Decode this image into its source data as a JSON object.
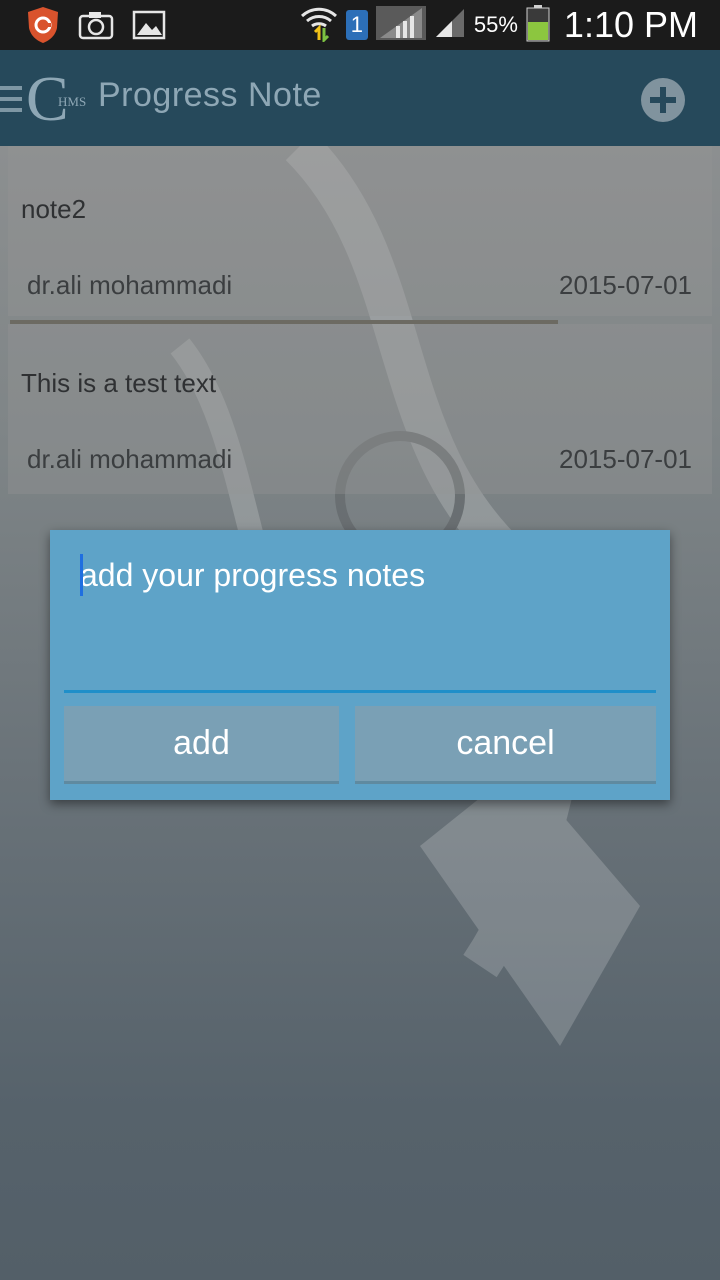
{
  "status_bar": {
    "battery_percent": "55%",
    "time": "1:10 PM",
    "sim_badge": "1",
    "icons": [
      "shield-app-icon",
      "camera-icon",
      "gallery-icon",
      "wifi-icon",
      "sim-icon",
      "signal-icon",
      "signal-icon",
      "battery-icon"
    ]
  },
  "app_bar": {
    "logo_letter": "C",
    "logo_sub": "HMS",
    "title": "Progress Note"
  },
  "notes": [
    {
      "title": "note2",
      "author": "dr.ali mohammadi",
      "date": "2015-07-01"
    },
    {
      "title": "This is a test text",
      "author": "dr.ali mohammadi",
      "date": "2015-07-01"
    }
  ],
  "dialog": {
    "placeholder": "add your progress notes",
    "add_label": "add",
    "cancel_label": "cancel"
  },
  "colors": {
    "app_bar": "#26495b",
    "dialog": "#5ea3c8",
    "button": "#7aa0b5",
    "accent": "#1f8fc9"
  }
}
